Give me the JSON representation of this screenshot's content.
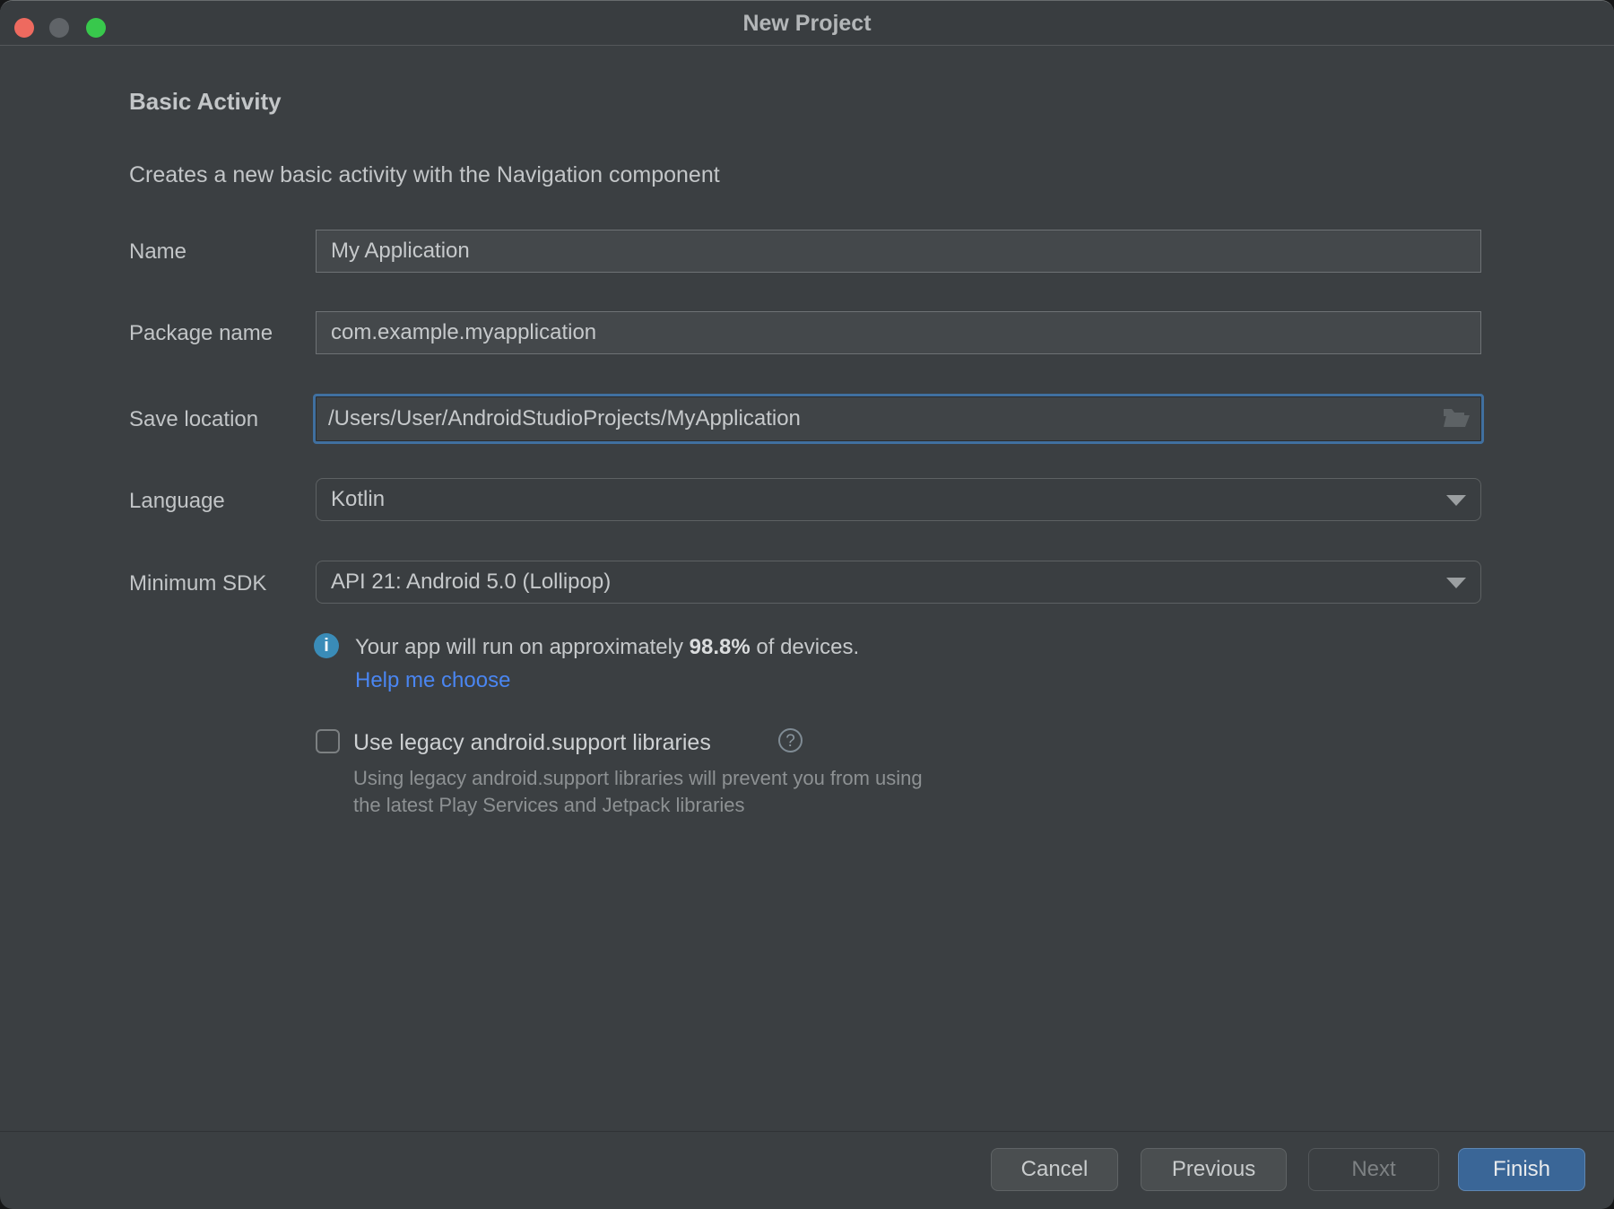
{
  "window": {
    "title": "New Project",
    "traffic_lights": {
      "close_color": "#ee6a5f",
      "minimize_color": "#606468",
      "zoom_color": "#38c84c"
    }
  },
  "header": {
    "title": "Basic Activity",
    "subtitle": "Creates a new basic activity with the Navigation component"
  },
  "form": {
    "name": {
      "label": "Name",
      "value": "My Application"
    },
    "package_name": {
      "label": "Package name",
      "value": "com.example.myapplication"
    },
    "save_location": {
      "label": "Save location",
      "value": "/Users/User/AndroidStudioProjects/MyApplication",
      "icon": "open-folder-icon"
    },
    "language": {
      "label": "Language",
      "value": "Kotlin"
    },
    "minimum_sdk": {
      "label": "Minimum SDK",
      "value": "API 21: Android 5.0 (Lollipop)"
    }
  },
  "sdk_info": {
    "icon_glyph": "i",
    "text_prefix": "Your app will run on approximately ",
    "percent": "98.8%",
    "text_suffix": " of devices.",
    "link_label": "Help me choose"
  },
  "legacy": {
    "checked": false,
    "label": "Use legacy android.support libraries",
    "help_glyph": "?",
    "description_line1": "Using legacy android.support libraries will prevent you from using",
    "description_line2": "the latest Play Services and Jetpack libraries"
  },
  "footer": {
    "cancel_label": "Cancel",
    "previous_label": "Previous",
    "next_label": "Next",
    "finish_label": "Finish"
  },
  "colors": {
    "window_background": "#3b3f42",
    "focus_border_blue": "#4070a0",
    "link_blue": "#4a86f2",
    "info_icon_blue": "#3a8cb8",
    "primary_button_blue": "#3a6697"
  }
}
